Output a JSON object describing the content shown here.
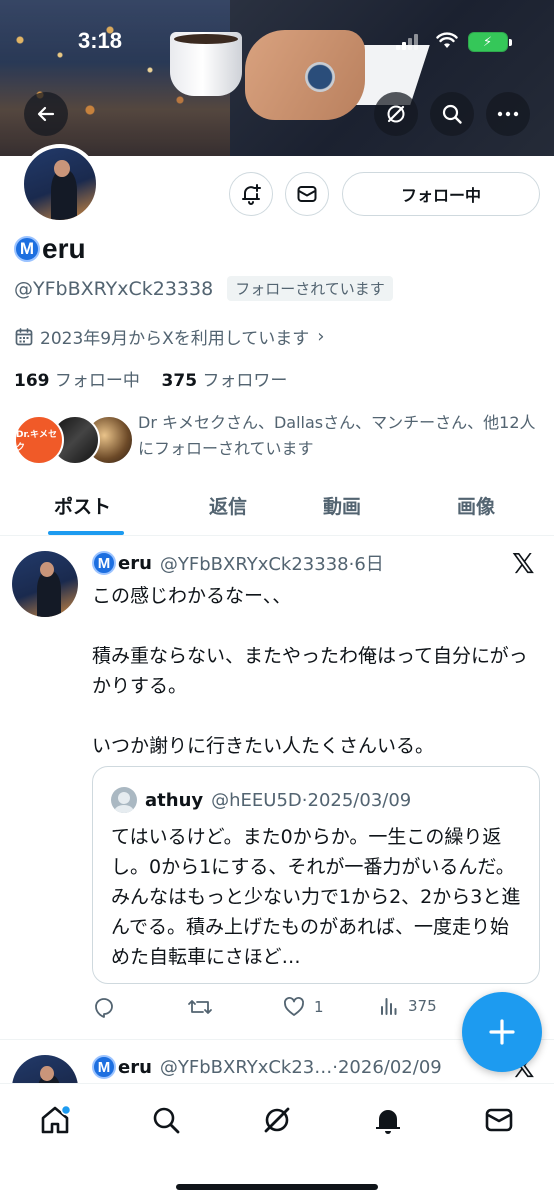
{
  "status_bar": {
    "time": "3:18"
  },
  "profile": {
    "name_badge_letter": "M",
    "name_rest": "eru",
    "handle": "@YFbBXRYxCk23338",
    "follows_you": "フォローされています",
    "joined": "2023年9月からXを利用しています",
    "following_count": "169",
    "following_label": "フォロー中",
    "followers_count": "375",
    "followers_label": "フォロワー",
    "follow_button": "フォロー中",
    "mutuals_text": "Dr キメセクさん、Dallasさん、マンチーさん、他12人にフォローされています",
    "mutual_avatar_label": "Dr.キメセク"
  },
  "tabs": [
    {
      "label": "ポスト",
      "active": true
    },
    {
      "label": "返信",
      "active": false
    },
    {
      "label": "動画",
      "active": false
    },
    {
      "label": "画像",
      "active": false
    }
  ],
  "post1": {
    "badge": "M",
    "name_rest": "eru",
    "handle_time": "@YFbBXRYxCk23338·6日",
    "body": "この感じわかるなー、、\n\n積み重ならない、またやったわ俺はって自分にがっかりする。\n\nいつか謝りに行きたい人たくさんいる。",
    "quote": {
      "name": "athuy",
      "handle_time": "@hEEU5D·2025/03/09",
      "body": "てはいるけど。また0からか。一生この繰り返し。0から1にする、それが一番力がいるんだ。みんなはもっと少ない力で1から2、2から3と進んでる。積み上げたものがあれば、一度走り始めた自転車にさほど…"
    },
    "likes": "1",
    "views": "375"
  },
  "post2": {
    "badge": "M",
    "name_rest": "eru",
    "handle_time": "@YFbBXRYxCk23…·2026/02/09"
  },
  "icons": {
    "x_logo": "𝕏"
  },
  "colors": {
    "accent": "#1d9bf0",
    "text": "#0f1419",
    "secondary": "#536471",
    "badge_blue": "#1d6fe0"
  }
}
